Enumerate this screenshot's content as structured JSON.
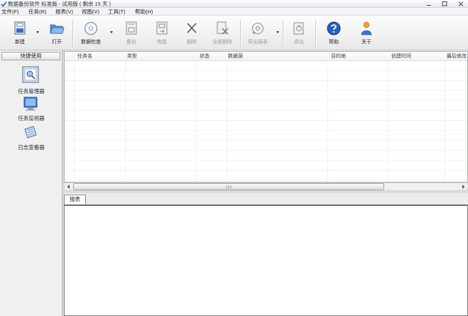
{
  "window": {
    "title": "数据备份软件 标准版 - 试用版 ( 剩余 15 天 )",
    "icon": "app-logo-icon",
    "controls": {
      "minimize": "minimize-icon",
      "maximize": "maximize-icon",
      "close": "close-icon"
    }
  },
  "menu": {
    "items": [
      {
        "label": "文件(F)"
      },
      {
        "label": "任务(R)"
      },
      {
        "label": "报表(V)"
      },
      {
        "label": "视图(V)"
      },
      {
        "label": "工具(T)"
      },
      {
        "label": "帮助(H)"
      }
    ]
  },
  "toolbar": {
    "buttons": [
      {
        "label": "新建",
        "icon": "new-task-icon",
        "enabled": true,
        "has_dropdown": true
      },
      {
        "label": "打开",
        "icon": "folder-open-icon",
        "enabled": true,
        "has_dropdown": false
      },
      {
        "label": "数据检查",
        "icon": "disc-check-icon",
        "enabled": true,
        "has_dropdown": true
      },
      {
        "label": "备份",
        "icon": "backup-icon",
        "enabled": false,
        "has_dropdown": false
      },
      {
        "label": "恢复",
        "icon": "restore-icon",
        "enabled": false,
        "has_dropdown": false
      },
      {
        "label": "删除",
        "icon": "delete-icon",
        "enabled": false,
        "has_dropdown": false
      },
      {
        "label": "全部删除",
        "icon": "delete-all-icon",
        "enabled": false,
        "has_dropdown": false
      },
      {
        "label": "导出报表",
        "icon": "export-report-icon",
        "enabled": false,
        "has_dropdown": true
      },
      {
        "label": "退出",
        "icon": "exit-icon",
        "enabled": false,
        "has_dropdown": false
      },
      {
        "label": "帮助",
        "icon": "help-icon",
        "enabled": true,
        "has_dropdown": false
      },
      {
        "label": "关于",
        "icon": "about-icon",
        "enabled": true,
        "has_dropdown": false
      }
    ]
  },
  "sidebar": {
    "title": "快捷使用",
    "items": [
      {
        "label": "任务管理器",
        "icon": "task-manager-icon"
      },
      {
        "label": "任务监视器",
        "icon": "task-monitor-icon"
      },
      {
        "label": "日志查看器",
        "icon": "log-viewer-icon"
      }
    ]
  },
  "task_table": {
    "columns": [
      "任务名",
      "类型",
      "状态",
      "数据源",
      "目的地",
      "创建时间",
      "最后修改"
    ],
    "rows": []
  },
  "report_panel": {
    "tabs": [
      {
        "label": "报表",
        "active": true
      }
    ]
  },
  "colors": {
    "accent": "#3c6ea8",
    "disabled_text": "#9a9a9a",
    "window_background": "#ececec"
  }
}
